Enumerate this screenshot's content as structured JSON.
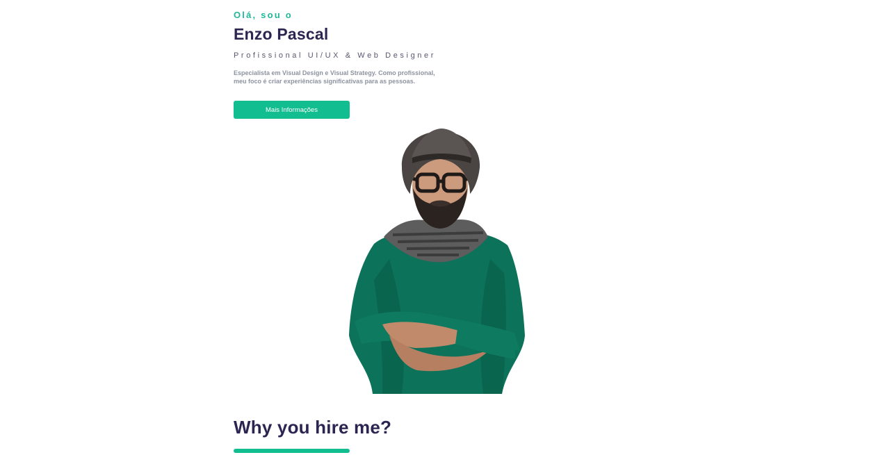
{
  "hero": {
    "greeting": "Olá, sou o",
    "name": "Enzo Pascal",
    "role": "Profissional UI/UX & Web Designer",
    "description": "Especialista em Visual Design e Visual Strategy. Como profissional, meu foco é criar experiências significativas para as pessoas.",
    "cta_label": "Mais Informações"
  },
  "portrait": {
    "subject": "man with hat, glasses, scarf and green sweater, arms crossed"
  },
  "why_section": {
    "title": "Why you hire me?"
  },
  "colors": {
    "accent": "#12bd8f",
    "accent_text": "#20b79a",
    "heading": "#2c2552",
    "muted": "#8d93a0"
  }
}
